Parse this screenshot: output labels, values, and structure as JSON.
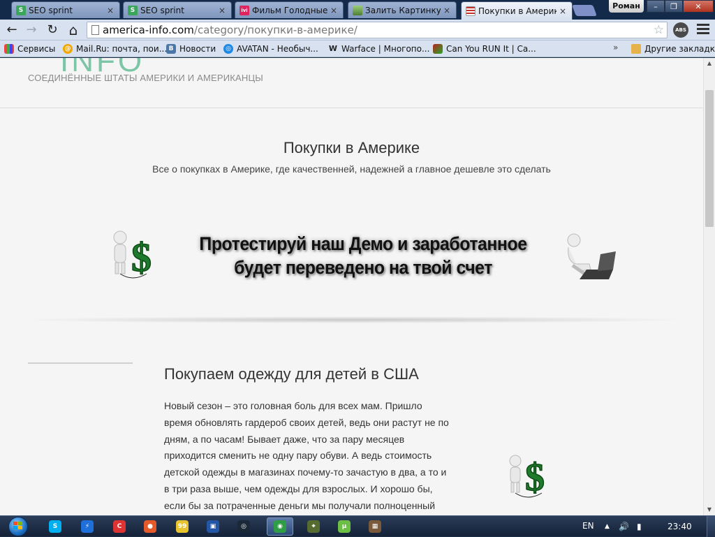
{
  "browser": {
    "tabs": [
      {
        "title": "SEO sprint",
        "favicon": "seosprint-icon",
        "color": "#3ba55c",
        "glyph": "S"
      },
      {
        "title": "SEO sprint",
        "favicon": "seosprint-icon",
        "color": "#3ba55c",
        "glyph": "S"
      },
      {
        "title": "Фильм Голодные и",
        "favicon": "ivi-icon",
        "color": "#e0245e",
        "glyph": "ivi"
      },
      {
        "title": "Залить Картинку - З",
        "favicon": "image-upload-icon",
        "color": "#6a9a50",
        "glyph": ""
      },
      {
        "title": "Покупки в Америк",
        "favicon": "us-flag-icon",
        "color": "#c4302b",
        "glyph": ""
      }
    ],
    "tab_close_glyph": "×",
    "user_name": "Роман",
    "window_controls": {
      "minimize": "–",
      "maximize": "❐",
      "close": "✕"
    },
    "url_host": "america-info.com",
    "url_path": "/category/покупки-в-америке/",
    "bookmark_star": "☆",
    "extension_label": "ABS",
    "nav": {
      "back": "←",
      "forward": "→",
      "reload": "↻",
      "home": "⌂"
    },
    "bookmarks": [
      {
        "label": "Сервисы",
        "icon": "apps-grid-icon",
        "color": "#e44"
      },
      {
        "label": "Mail.Ru: почта, пои...",
        "icon": "mailru-icon",
        "color": "#1a5fb4"
      },
      {
        "label": "Новости",
        "icon": "vk-icon",
        "color": "#4a76a8"
      },
      {
        "label": "AVATAN - Необыч...",
        "icon": "avatan-icon",
        "color": "#1e88e5"
      },
      {
        "label": "Warface | Многопо...",
        "icon": "warface-icon",
        "color": "#222"
      },
      {
        "label": "Can You RUN It | Ca...",
        "icon": "canyourunit-icon",
        "color": "#b22"
      },
      {
        "label": "Другие закладки",
        "icon": "folder-icon",
        "color": "#e6b34a"
      }
    ],
    "bookmarks_more": "»"
  },
  "page": {
    "logo_fragment": "INFO",
    "tagline": "СОЕДИНЁННЫЕ ШТАТЫ АМЕРИКИ И АМЕРИКАНЦЫ",
    "category_title": "Покупки в Америке",
    "category_description": "Все о покупках в Америке, где качественней, надежней а главное дешевле это сделать",
    "banner_line1": "Протестируй наш Демо и заработанное",
    "banner_line2": "будет переведено на твой счет",
    "post_title": "Покупаем одежду для детей в США",
    "post_body": "Новый сезон – это головная боль для всех мам. Пришло время обновлять гардероб своих детей, ведь они растут не по дням, а по часам! Бывает даже, что за пару месяцев приходится сменить не одну пару обуви. А ведь стоимость детской одежды в магазинах почему-то зачастую в два, а то и в три раза выше, чем одежды для взрослых. И хорошо бы, если бы за потраченные деньги мы получали полноценный"
  },
  "scroll": {
    "position_fraction": 0.07
  },
  "taskbar": {
    "apps": [
      {
        "name": "skype-icon",
        "color": "#00aff0",
        "glyph": "S"
      },
      {
        "name": "lightning-app-icon",
        "color": "#1e6fd9",
        "glyph": "⚡"
      },
      {
        "name": "ccleaner-icon",
        "color": "#d33",
        "glyph": "C"
      },
      {
        "name": "map-pin-icon",
        "color": "#e55a2b",
        "glyph": "●"
      },
      {
        "name": "notes-icon",
        "color": "#e7c32f",
        "glyph": "99"
      },
      {
        "name": "floppy-save-icon",
        "color": "#2456a8",
        "glyph": "▣"
      },
      {
        "name": "steam-icon",
        "color": "#1b2838",
        "glyph": "◎"
      },
      {
        "name": "chrome-icon",
        "color": "#2f9d46",
        "glyph": "◉"
      },
      {
        "name": "sniper-app-icon",
        "color": "#556b2f",
        "glyph": "⌖"
      },
      {
        "name": "utorrent-icon",
        "color": "#6cbe45",
        "glyph": "µ"
      },
      {
        "name": "cube-app-icon",
        "color": "#7a5a3a",
        "glyph": "▦"
      }
    ],
    "language": "EN",
    "tray_up": "▲",
    "tray_volume": "🔊",
    "tray_network": "▮",
    "clock": "23:40"
  }
}
